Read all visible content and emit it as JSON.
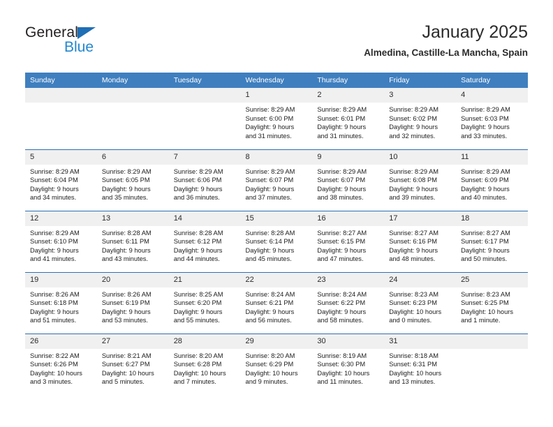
{
  "brand": {
    "name_part1": "General",
    "name_part2": "Blue",
    "triangle_color": "#1f6fb5",
    "blue_text_color": "#2387d0"
  },
  "header": {
    "title": "January 2025",
    "subtitle": "Almedina, Castille-La Mancha, Spain"
  },
  "theme": {
    "header_blue": "#3f7fbf",
    "row_divider": "#2f6fb0",
    "daynum_band": "#f0f0f0"
  },
  "weekday_headers": [
    "Sunday",
    "Monday",
    "Tuesday",
    "Wednesday",
    "Thursday",
    "Friday",
    "Saturday"
  ],
  "weeks": [
    [
      {
        "day": "",
        "empty": true,
        "sunrise": "",
        "sunset": "",
        "daylight_l1": "",
        "daylight_l2": ""
      },
      {
        "day": "",
        "empty": true,
        "sunrise": "",
        "sunset": "",
        "daylight_l1": "",
        "daylight_l2": ""
      },
      {
        "day": "",
        "empty": true,
        "sunrise": "",
        "sunset": "",
        "daylight_l1": "",
        "daylight_l2": ""
      },
      {
        "day": "1",
        "empty": false,
        "sunrise": "Sunrise: 8:29 AM",
        "sunset": "Sunset: 6:00 PM",
        "daylight_l1": "Daylight: 9 hours",
        "daylight_l2": "and 31 minutes."
      },
      {
        "day": "2",
        "empty": false,
        "sunrise": "Sunrise: 8:29 AM",
        "sunset": "Sunset: 6:01 PM",
        "daylight_l1": "Daylight: 9 hours",
        "daylight_l2": "and 31 minutes."
      },
      {
        "day": "3",
        "empty": false,
        "sunrise": "Sunrise: 8:29 AM",
        "sunset": "Sunset: 6:02 PM",
        "daylight_l1": "Daylight: 9 hours",
        "daylight_l2": "and 32 minutes."
      },
      {
        "day": "4",
        "empty": false,
        "sunrise": "Sunrise: 8:29 AM",
        "sunset": "Sunset: 6:03 PM",
        "daylight_l1": "Daylight: 9 hours",
        "daylight_l2": "and 33 minutes."
      }
    ],
    [
      {
        "day": "5",
        "empty": false,
        "sunrise": "Sunrise: 8:29 AM",
        "sunset": "Sunset: 6:04 PM",
        "daylight_l1": "Daylight: 9 hours",
        "daylight_l2": "and 34 minutes."
      },
      {
        "day": "6",
        "empty": false,
        "sunrise": "Sunrise: 8:29 AM",
        "sunset": "Sunset: 6:05 PM",
        "daylight_l1": "Daylight: 9 hours",
        "daylight_l2": "and 35 minutes."
      },
      {
        "day": "7",
        "empty": false,
        "sunrise": "Sunrise: 8:29 AM",
        "sunset": "Sunset: 6:06 PM",
        "daylight_l1": "Daylight: 9 hours",
        "daylight_l2": "and 36 minutes."
      },
      {
        "day": "8",
        "empty": false,
        "sunrise": "Sunrise: 8:29 AM",
        "sunset": "Sunset: 6:07 PM",
        "daylight_l1": "Daylight: 9 hours",
        "daylight_l2": "and 37 minutes."
      },
      {
        "day": "9",
        "empty": false,
        "sunrise": "Sunrise: 8:29 AM",
        "sunset": "Sunset: 6:07 PM",
        "daylight_l1": "Daylight: 9 hours",
        "daylight_l2": "and 38 minutes."
      },
      {
        "day": "10",
        "empty": false,
        "sunrise": "Sunrise: 8:29 AM",
        "sunset": "Sunset: 6:08 PM",
        "daylight_l1": "Daylight: 9 hours",
        "daylight_l2": "and 39 minutes."
      },
      {
        "day": "11",
        "empty": false,
        "sunrise": "Sunrise: 8:29 AM",
        "sunset": "Sunset: 6:09 PM",
        "daylight_l1": "Daylight: 9 hours",
        "daylight_l2": "and 40 minutes."
      }
    ],
    [
      {
        "day": "12",
        "empty": false,
        "sunrise": "Sunrise: 8:29 AM",
        "sunset": "Sunset: 6:10 PM",
        "daylight_l1": "Daylight: 9 hours",
        "daylight_l2": "and 41 minutes."
      },
      {
        "day": "13",
        "empty": false,
        "sunrise": "Sunrise: 8:28 AM",
        "sunset": "Sunset: 6:11 PM",
        "daylight_l1": "Daylight: 9 hours",
        "daylight_l2": "and 43 minutes."
      },
      {
        "day": "14",
        "empty": false,
        "sunrise": "Sunrise: 8:28 AM",
        "sunset": "Sunset: 6:12 PM",
        "daylight_l1": "Daylight: 9 hours",
        "daylight_l2": "and 44 minutes."
      },
      {
        "day": "15",
        "empty": false,
        "sunrise": "Sunrise: 8:28 AM",
        "sunset": "Sunset: 6:14 PM",
        "daylight_l1": "Daylight: 9 hours",
        "daylight_l2": "and 45 minutes."
      },
      {
        "day": "16",
        "empty": false,
        "sunrise": "Sunrise: 8:27 AM",
        "sunset": "Sunset: 6:15 PM",
        "daylight_l1": "Daylight: 9 hours",
        "daylight_l2": "and 47 minutes."
      },
      {
        "day": "17",
        "empty": false,
        "sunrise": "Sunrise: 8:27 AM",
        "sunset": "Sunset: 6:16 PM",
        "daylight_l1": "Daylight: 9 hours",
        "daylight_l2": "and 48 minutes."
      },
      {
        "day": "18",
        "empty": false,
        "sunrise": "Sunrise: 8:27 AM",
        "sunset": "Sunset: 6:17 PM",
        "daylight_l1": "Daylight: 9 hours",
        "daylight_l2": "and 50 minutes."
      }
    ],
    [
      {
        "day": "19",
        "empty": false,
        "sunrise": "Sunrise: 8:26 AM",
        "sunset": "Sunset: 6:18 PM",
        "daylight_l1": "Daylight: 9 hours",
        "daylight_l2": "and 51 minutes."
      },
      {
        "day": "20",
        "empty": false,
        "sunrise": "Sunrise: 8:26 AM",
        "sunset": "Sunset: 6:19 PM",
        "daylight_l1": "Daylight: 9 hours",
        "daylight_l2": "and 53 minutes."
      },
      {
        "day": "21",
        "empty": false,
        "sunrise": "Sunrise: 8:25 AM",
        "sunset": "Sunset: 6:20 PM",
        "daylight_l1": "Daylight: 9 hours",
        "daylight_l2": "and 55 minutes."
      },
      {
        "day": "22",
        "empty": false,
        "sunrise": "Sunrise: 8:24 AM",
        "sunset": "Sunset: 6:21 PM",
        "daylight_l1": "Daylight: 9 hours",
        "daylight_l2": "and 56 minutes."
      },
      {
        "day": "23",
        "empty": false,
        "sunrise": "Sunrise: 8:24 AM",
        "sunset": "Sunset: 6:22 PM",
        "daylight_l1": "Daylight: 9 hours",
        "daylight_l2": "and 58 minutes."
      },
      {
        "day": "24",
        "empty": false,
        "sunrise": "Sunrise: 8:23 AM",
        "sunset": "Sunset: 6:23 PM",
        "daylight_l1": "Daylight: 10 hours",
        "daylight_l2": "and 0 minutes."
      },
      {
        "day": "25",
        "empty": false,
        "sunrise": "Sunrise: 8:23 AM",
        "sunset": "Sunset: 6:25 PM",
        "daylight_l1": "Daylight: 10 hours",
        "daylight_l2": "and 1 minute."
      }
    ],
    [
      {
        "day": "26",
        "empty": false,
        "sunrise": "Sunrise: 8:22 AM",
        "sunset": "Sunset: 6:26 PM",
        "daylight_l1": "Daylight: 10 hours",
        "daylight_l2": "and 3 minutes."
      },
      {
        "day": "27",
        "empty": false,
        "sunrise": "Sunrise: 8:21 AM",
        "sunset": "Sunset: 6:27 PM",
        "daylight_l1": "Daylight: 10 hours",
        "daylight_l2": "and 5 minutes."
      },
      {
        "day": "28",
        "empty": false,
        "sunrise": "Sunrise: 8:20 AM",
        "sunset": "Sunset: 6:28 PM",
        "daylight_l1": "Daylight: 10 hours",
        "daylight_l2": "and 7 minutes."
      },
      {
        "day": "29",
        "empty": false,
        "sunrise": "Sunrise: 8:20 AM",
        "sunset": "Sunset: 6:29 PM",
        "daylight_l1": "Daylight: 10 hours",
        "daylight_l2": "and 9 minutes."
      },
      {
        "day": "30",
        "empty": false,
        "sunrise": "Sunrise: 8:19 AM",
        "sunset": "Sunset: 6:30 PM",
        "daylight_l1": "Daylight: 10 hours",
        "daylight_l2": "and 11 minutes."
      },
      {
        "day": "31",
        "empty": false,
        "sunrise": "Sunrise: 8:18 AM",
        "sunset": "Sunset: 6:31 PM",
        "daylight_l1": "Daylight: 10 hours",
        "daylight_l2": "and 13 minutes."
      },
      {
        "day": "",
        "empty": true,
        "sunrise": "",
        "sunset": "",
        "daylight_l1": "",
        "daylight_l2": ""
      }
    ]
  ]
}
